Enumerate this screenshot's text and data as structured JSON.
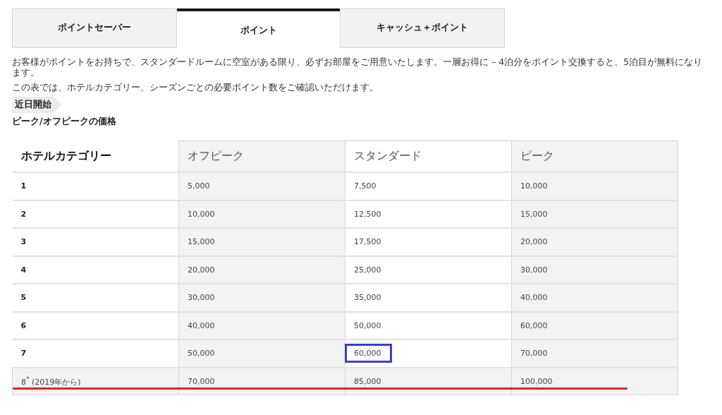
{
  "tabs": [
    {
      "label": "ポイントセーバー",
      "selected": false
    },
    {
      "label": "ポイント",
      "selected": true
    },
    {
      "label": "キャッシュ＋ポイント",
      "selected": false
    }
  ],
  "paragraphs": [
    "お客様がポイントをお持ちで、スタンダードルームに空室がある限り、必ずお部屋をご用意いたします。一層お得に – 4泊分をポイント交換すると、5泊目が無料になります。",
    "この表では、ホテルカテゴリー、シーズンごとの必要ポイント数をご確認いただけます。"
  ],
  "badge": "近日開始",
  "subtitle": "ピーク/オフピークの価格",
  "table": {
    "columns": [
      "ホテルカテゴリー",
      "オフピーク",
      "スタンダード",
      "ピーク"
    ],
    "rows": [
      {
        "kind": "standard",
        "underlined": false,
        "cells": [
          {
            "text": "1",
            "highlighted": false
          },
          {
            "text": "5,000",
            "highlighted": false
          },
          {
            "text": "7,500",
            "highlighted": false
          },
          {
            "text": "10,000",
            "highlighted": false
          }
        ]
      },
      {
        "kind": "standard",
        "underlined": false,
        "cells": [
          {
            "text": "2",
            "highlighted": false
          },
          {
            "text": "10,000",
            "highlighted": false
          },
          {
            "text": "12,500",
            "highlighted": false
          },
          {
            "text": "15,000",
            "highlighted": false
          }
        ]
      },
      {
        "kind": "standard",
        "underlined": false,
        "cells": [
          {
            "text": "3",
            "highlighted": false
          },
          {
            "text": "15,000",
            "highlighted": false
          },
          {
            "text": "17,500",
            "highlighted": false
          },
          {
            "text": "20,000",
            "highlighted": false
          }
        ]
      },
      {
        "kind": "standard",
        "underlined": false,
        "cells": [
          {
            "text": "4",
            "highlighted": false
          },
          {
            "text": "20,000",
            "highlighted": false
          },
          {
            "text": "25,000",
            "highlighted": false
          },
          {
            "text": "30,000",
            "highlighted": false
          }
        ]
      },
      {
        "kind": "standard",
        "underlined": false,
        "cells": [
          {
            "text": "5",
            "highlighted": false
          },
          {
            "text": "30,000",
            "highlighted": false
          },
          {
            "text": "35,000",
            "highlighted": false
          },
          {
            "text": "40,000",
            "highlighted": false
          }
        ]
      },
      {
        "kind": "standard",
        "underlined": false,
        "cells": [
          {
            "text": "6",
            "highlighted": false
          },
          {
            "text": "40,000",
            "highlighted": false
          },
          {
            "text": "50,000",
            "highlighted": false
          },
          {
            "text": "60,000",
            "highlighted": false
          }
        ]
      },
      {
        "kind": "standard",
        "underlined": false,
        "cells": [
          {
            "text": "7",
            "highlighted": false
          },
          {
            "text": "50,000",
            "highlighted": false
          },
          {
            "text": "60,000",
            "highlighted": true
          },
          {
            "text": "70,000",
            "highlighted": false
          }
        ]
      },
      {
        "kind": "note",
        "underlined": true,
        "cells": [
          {
            "text": "8$^{*}$ (2019年から)",
            "highlighted": false
          },
          {
            "text": "70,000",
            "highlighted": false
          },
          {
            "text": "85,000",
            "highlighted": false
          },
          {
            "text": "100,000",
            "highlighted": false
          }
        ]
      }
    ]
  }
}
